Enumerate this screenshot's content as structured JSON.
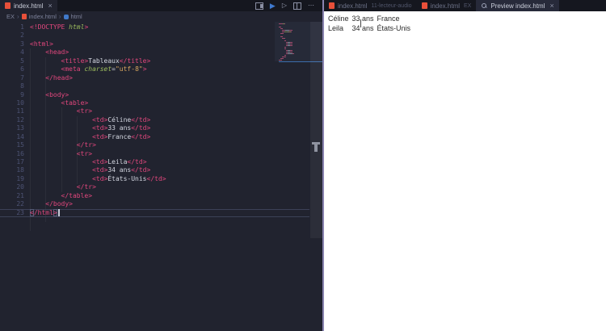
{
  "left_editor": {
    "tab": {
      "label": "index.html",
      "close_label": "×"
    },
    "toolbar": {
      "more_label": "⋯"
    },
    "breadcrumb": {
      "folder": "EX",
      "file": "index.html",
      "symbol": "html",
      "separator": "›"
    },
    "code": {
      "language": "html",
      "current_line": 23,
      "lines": [
        [
          [
            "p",
            "<!DOCTYPE "
          ],
          [
            "g",
            "html"
          ],
          [
            "p",
            ">"
          ]
        ],
        [],
        [
          [
            "p",
            "<html>"
          ]
        ],
        [
          [
            "w",
            "    "
          ],
          [
            "p",
            "<head>"
          ]
        ],
        [
          [
            "w",
            "        "
          ],
          [
            "p",
            "<title>"
          ],
          [
            "w",
            "Tableaux"
          ],
          [
            "p",
            "</title>"
          ]
        ],
        [
          [
            "w",
            "        "
          ],
          [
            "p",
            "<meta "
          ],
          [
            "g",
            "charset"
          ],
          [
            "w",
            "="
          ],
          [
            "y",
            "\"utf-8\""
          ],
          [
            "p",
            ">"
          ]
        ],
        [
          [
            "w",
            "    "
          ],
          [
            "p",
            "</head>"
          ]
        ],
        [],
        [
          [
            "w",
            "    "
          ],
          [
            "p",
            "<body>"
          ]
        ],
        [
          [
            "w",
            "        "
          ],
          [
            "p",
            "<table>"
          ]
        ],
        [
          [
            "w",
            "            "
          ],
          [
            "p",
            "<tr>"
          ]
        ],
        [
          [
            "w",
            "                "
          ],
          [
            "p",
            "<td>"
          ],
          [
            "w",
            "Céline"
          ],
          [
            "p",
            "</td>"
          ]
        ],
        [
          [
            "w",
            "                "
          ],
          [
            "p",
            "<td>"
          ],
          [
            "w",
            "33 ans"
          ],
          [
            "p",
            "</td>"
          ]
        ],
        [
          [
            "w",
            "                "
          ],
          [
            "p",
            "<td>"
          ],
          [
            "w",
            "France"
          ],
          [
            "p",
            "</td>"
          ]
        ],
        [
          [
            "w",
            "            "
          ],
          [
            "p",
            "</tr>"
          ]
        ],
        [
          [
            "w",
            "            "
          ],
          [
            "p",
            "<tr>"
          ]
        ],
        [
          [
            "w",
            "                "
          ],
          [
            "p",
            "<td>"
          ],
          [
            "w",
            "Leila"
          ],
          [
            "p",
            "</td>"
          ]
        ],
        [
          [
            "w",
            "                "
          ],
          [
            "p",
            "<td>"
          ],
          [
            "w",
            "34 ans"
          ],
          [
            "p",
            "</td>"
          ]
        ],
        [
          [
            "w",
            "                "
          ],
          [
            "p",
            "<td>"
          ],
          [
            "w",
            "États-Unis"
          ],
          [
            "p",
            "</td>"
          ]
        ],
        [
          [
            "w",
            "            "
          ],
          [
            "p",
            "</tr>"
          ]
        ],
        [
          [
            "w",
            "        "
          ],
          [
            "p",
            "</table>"
          ]
        ],
        [
          [
            "w",
            "    "
          ],
          [
            "p",
            "</body>"
          ]
        ],
        [
          [
            "pb",
            "<"
          ],
          [
            "p",
            "/html"
          ],
          [
            "pb",
            ">"
          ],
          [
            "cursor",
            ""
          ]
        ]
      ]
    }
  },
  "right_editor": {
    "tabs": [
      {
        "label": "index.html",
        "detail": "11-lecteur-audio"
      },
      {
        "label": "index.html",
        "detail": "EX"
      },
      {
        "label": "Preview index.html",
        "close_label": "×"
      }
    ],
    "preview": {
      "rows": [
        [
          "Céline",
          "33 ans",
          "France"
        ],
        [
          "Leila",
          "34 ans",
          "États-Unis"
        ]
      ]
    }
  },
  "colors": {
    "editor_background": "#21232f",
    "tabbar_background": "#15171f",
    "tag_pink": "#e2477d",
    "attr_green": "#9ebe5e",
    "string_yellow": "#d7a65f",
    "file_icon_orange": "#e8503a",
    "run_blue": "#3f7ad0",
    "divider_purple": "#8a84b0",
    "preview_background": "#ffffff"
  }
}
